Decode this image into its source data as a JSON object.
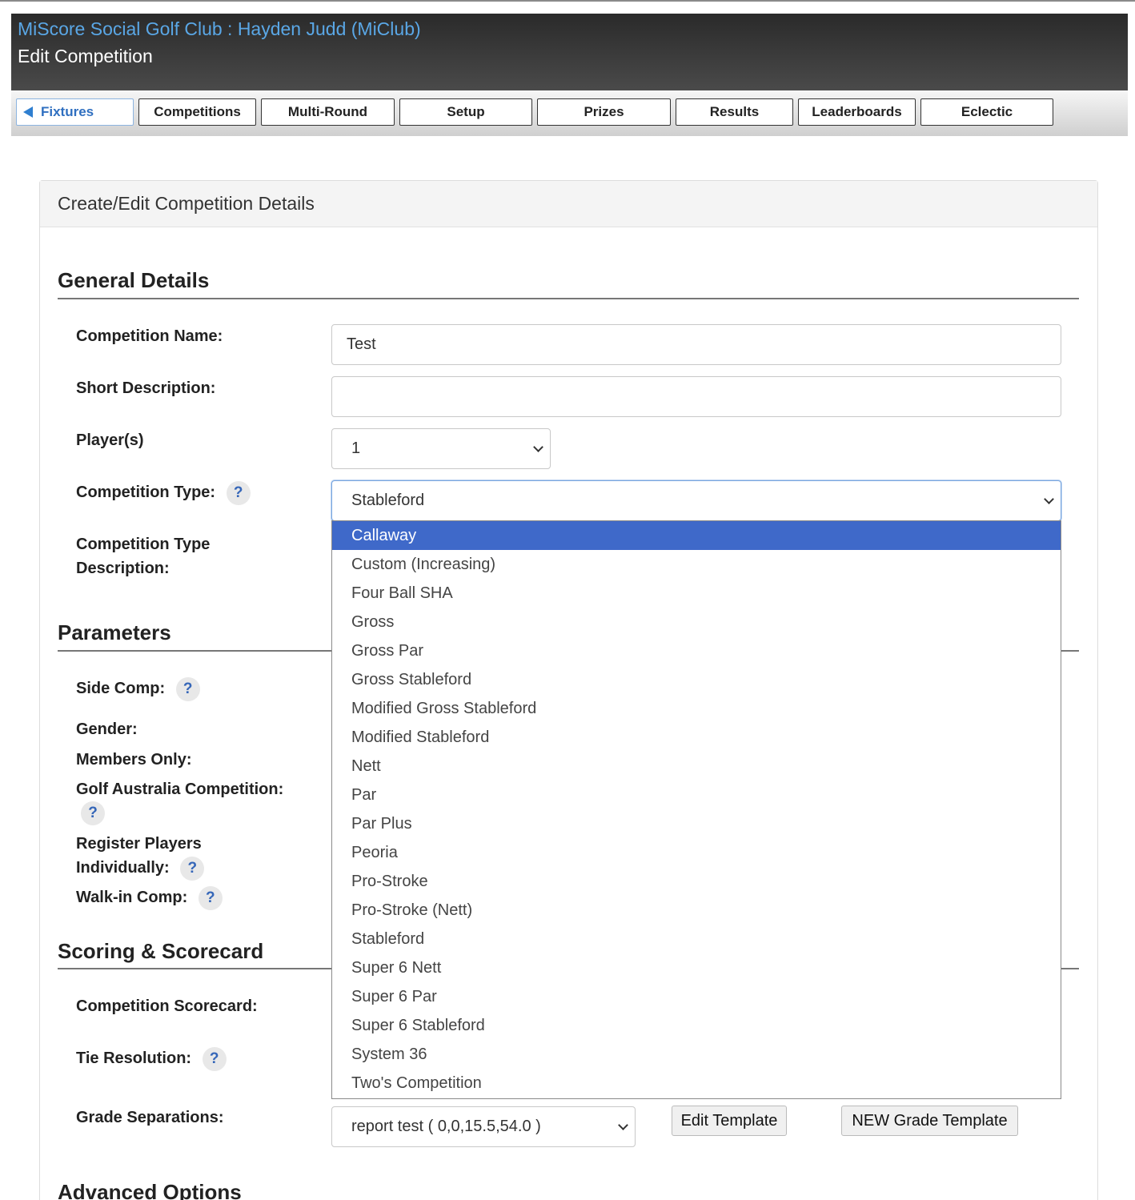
{
  "header": {
    "club_title": "MiScore Social Golf Club : Hayden Judd (MiClub)",
    "page_title": "Edit Competition"
  },
  "nav": {
    "back_label": "Fixtures",
    "tabs": [
      "Competitions",
      "Multi-Round",
      "Setup",
      "Prizes",
      "Results",
      "Leaderboards",
      "Eclectic"
    ]
  },
  "panel": {
    "title": "Create/Edit Competition Details"
  },
  "general": {
    "heading": "General Details",
    "name_label": "Competition Name:",
    "name_value": "Test",
    "short_desc_label": "Short Description:",
    "short_desc_value": "",
    "players_label": "Player(s)",
    "players_value": "1",
    "type_label": "Competition Type:",
    "type_value": "Stableford",
    "type_desc_label_1": "Competition Type",
    "type_desc_label_2": "Description:"
  },
  "help_mark": "?",
  "parameters": {
    "heading": "Parameters",
    "side_comp": "Side Comp:",
    "gender": "Gender:",
    "members_only": "Members Only:",
    "golf_australia": "Golf Australia Competition:",
    "register_1": "Register Players",
    "register_2": "Individually:",
    "walk_in": "Walk-in Comp:"
  },
  "scoring": {
    "heading": "Scoring & Scorecard",
    "scorecard_label": "Competition Scorecard:",
    "tie_label": "Tie Resolution:",
    "grade_label": "Grade Separations:",
    "grade_value": "report test ( 0,0,15.5,54.0 )",
    "edit_template": "Edit Template",
    "new_template": "NEW Grade Template"
  },
  "advanced": {
    "heading": "Advanced Options"
  },
  "dropdown": {
    "highlighted": "Callaway",
    "options": [
      "Callaway",
      "Custom (Increasing)",
      "Four Ball SHA",
      "Gross",
      "Gross Par",
      "Gross Stableford",
      "Modified Gross Stableford",
      "Modified Stableford",
      "Nett",
      "Par",
      "Par Plus",
      "Peoria",
      "Pro-Stroke",
      "Pro-Stroke (Nett)",
      "Stableford",
      "Super 6 Nett",
      "Super 6 Par",
      "Super 6 Stableford",
      "System 36",
      "Two's Competition"
    ]
  },
  "colors": {
    "accent_blue": "#5aa7e6",
    "highlight": "#3f69c9",
    "help_blue": "#3566b8"
  }
}
